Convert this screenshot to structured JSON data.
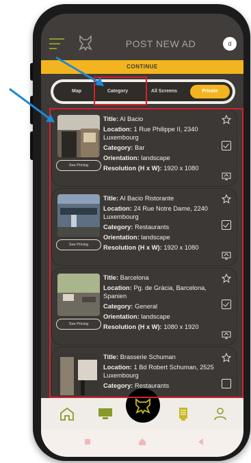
{
  "header": {
    "title": "POST NEW AD",
    "avatar_letter": "d",
    "menu_icon": "hamburger-icon",
    "logo_icon": "bear-logo-icon"
  },
  "continue_label": "CONTINUE",
  "tabs": [
    {
      "label": "Map"
    },
    {
      "label": "Category"
    },
    {
      "label": "All Screens"
    },
    {
      "label": "Private",
      "active": true
    }
  ],
  "colors": {
    "accent": "#f3b51f",
    "dark": "#3d3a37",
    "highlight_red": "#d71f2a",
    "arrow_blue": "#1f88d8"
  },
  "labels": {
    "title": "Title:",
    "location": "Location:",
    "category": "Category:",
    "orientation": "Orientation:",
    "resolution": "Resolution (H x W):",
    "see_pricing": "See Pricing"
  },
  "listings": [
    {
      "title": "Al Bacio",
      "location": "1 Rue Philippe II, 2340 Luxembourg",
      "category": "Bar",
      "orientation": "landscape",
      "resolution": "1920 x 1080",
      "checked": true
    },
    {
      "title": "Al Bacio Ristorante",
      "location": "24 Rue Notre Dame, 2240 Luxembourg",
      "category": "Restaurants",
      "orientation": "landscape",
      "resolution": "1920 x 1080",
      "checked": true
    },
    {
      "title": "Barcelona",
      "location": "Pg. de Gràcia, Barcelona, Spanien",
      "category": "General",
      "orientation": "landscape",
      "resolution": "1080 x 1920",
      "checked": true
    },
    {
      "title": "Brasserie Schuman",
      "location": "1 Bd Robert Schuman, 2525 Luxembourg",
      "category": "Restaurants",
      "orientation": "",
      "resolution": "",
      "checked": false
    }
  ],
  "bottom_nav": [
    "home-icon",
    "monitor-icon",
    "bear-center-icon",
    "document-icon",
    "profile-icon"
  ]
}
